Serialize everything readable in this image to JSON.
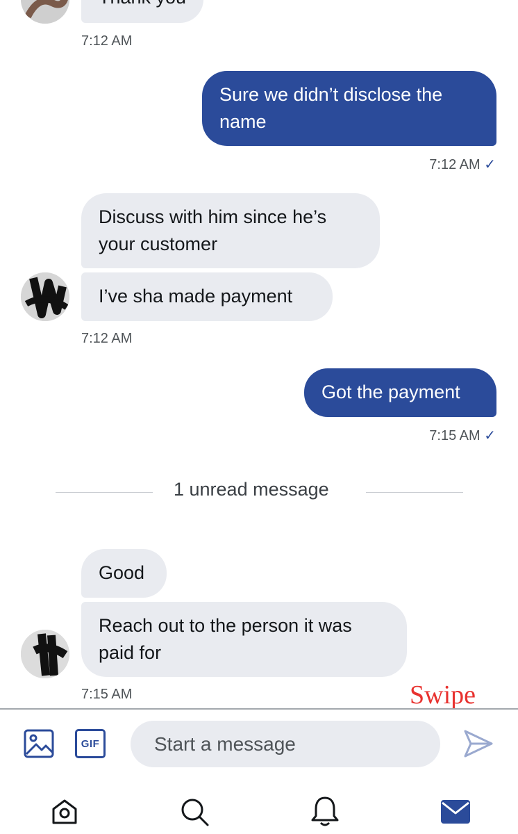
{
  "conversation": {
    "messages": [
      {
        "direction": "incoming",
        "text": "Thank you",
        "time": "7:12 AM"
      },
      {
        "direction": "outgoing",
        "text": "Sure we didn’t disclose the name",
        "time": "7:12 AM",
        "status": "✓"
      },
      {
        "direction": "incoming",
        "text": "Discuss with him since he’s your customer"
      },
      {
        "direction": "incoming",
        "text": "I’ve sha made payment",
        "time": "7:12 AM"
      },
      {
        "direction": "outgoing",
        "text": "Got the payment",
        "time": "7:15 AM",
        "status": "✓"
      },
      {
        "direction": "incoming",
        "text": "Good"
      },
      {
        "direction": "incoming",
        "text": "Reach out to the person it was paid for",
        "time": "7:15 AM"
      }
    ],
    "unread_divider": "1 unread message"
  },
  "overlay": {
    "swipe_label": "Swipe",
    "swipe_color": "#e8322f"
  },
  "composer": {
    "placeholder": "Start a message",
    "image_icon": "image-icon",
    "gif_label": "GIF",
    "send_icon": "send-icon"
  },
  "bottom_nav": {
    "items": [
      {
        "icon": "home-icon"
      },
      {
        "icon": "search-icon"
      },
      {
        "icon": "bell-icon"
      },
      {
        "icon": "mail-icon",
        "active": true
      }
    ]
  },
  "colors": {
    "accent": "#2b4b9a",
    "incoming_bubble": "#e9ebf0",
    "send_icon": "#9aa9cf"
  }
}
